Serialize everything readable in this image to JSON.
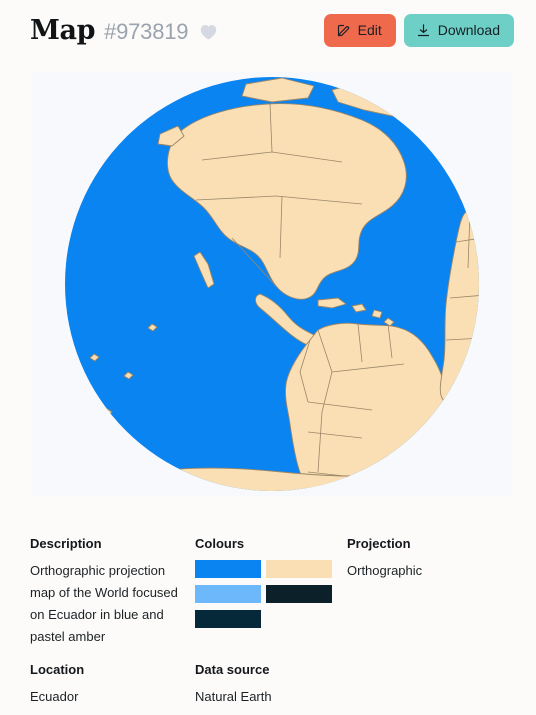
{
  "header": {
    "title": "Map",
    "map_id": "#973819",
    "favorite_icon": "heart-icon",
    "favorited": false,
    "edit_label": "Edit",
    "edit_icon": "pencil-square-icon",
    "download_label": "Download",
    "download_icon": "download-arrow-icon",
    "edit_color": "#EF6A4C",
    "download_color": "#6ECFC6"
  },
  "map_preview": {
    "alt": "Orthographic globe centred on Ecuador",
    "ocean_color": "#0A84F0",
    "land_color": "#FADFB4",
    "border_color": "#9A8668",
    "background_color": "#F7F9FC"
  },
  "details": {
    "description_label": "Description",
    "description_value": "Orthographic projection map of the World focused on Ecuador in blue and pastel amber",
    "colours_label": "Colours",
    "colours": [
      "#0A84F0",
      "#FADFB4",
      "#6CB8FA",
      "#0B2028",
      "#06293A"
    ],
    "projection_label": "Projection",
    "projection_value": "Orthographic",
    "location_label": "Location",
    "location_value": "Ecuador",
    "data_source_label": "Data source",
    "data_source_value": "Natural Earth"
  }
}
